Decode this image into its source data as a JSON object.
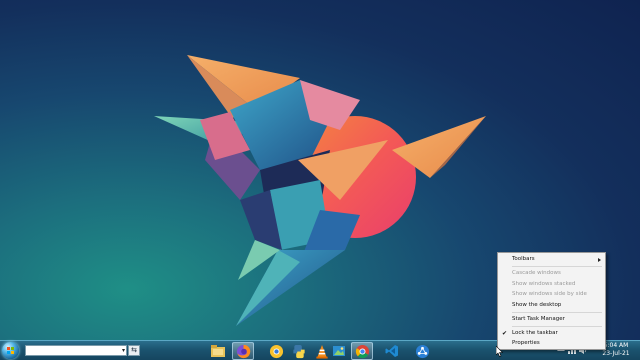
{
  "taskbar": {
    "address_value": "",
    "address_dropdown": "▾",
    "address_go": "⇆",
    "pinned": [
      {
        "name": "file-explorer"
      },
      {
        "name": "firefox",
        "active": true
      },
      {
        "name": "chrome-canary"
      },
      {
        "name": "python"
      },
      {
        "name": "vlc"
      },
      {
        "name": "gallery"
      },
      {
        "name": "chrome",
        "active": true
      },
      {
        "name": "vscode"
      },
      {
        "name": "network-app"
      }
    ],
    "clock": {
      "time": "5:04 AM",
      "date": "23-Jul-21"
    }
  },
  "context_menu": {
    "items": [
      {
        "label": "Toolbars",
        "enabled": true,
        "submenu": true
      },
      {
        "label": "Cascade windows",
        "enabled": false
      },
      {
        "label": "Show windows stacked",
        "enabled": false
      },
      {
        "label": "Show windows side by side",
        "enabled": false
      },
      {
        "label": "Show the desktop",
        "enabled": true
      },
      {
        "label": "Start Task Manager",
        "enabled": true
      },
      {
        "label": "Lock the taskbar",
        "enabled": true,
        "checked": true
      },
      {
        "label": "Properties",
        "enabled": true
      }
    ],
    "check_glyph": "✔"
  },
  "colors": {
    "taskbar": "#1b536f",
    "wallpaper_sun": "#f7545f",
    "menu_bg": "#f3f3f3"
  }
}
